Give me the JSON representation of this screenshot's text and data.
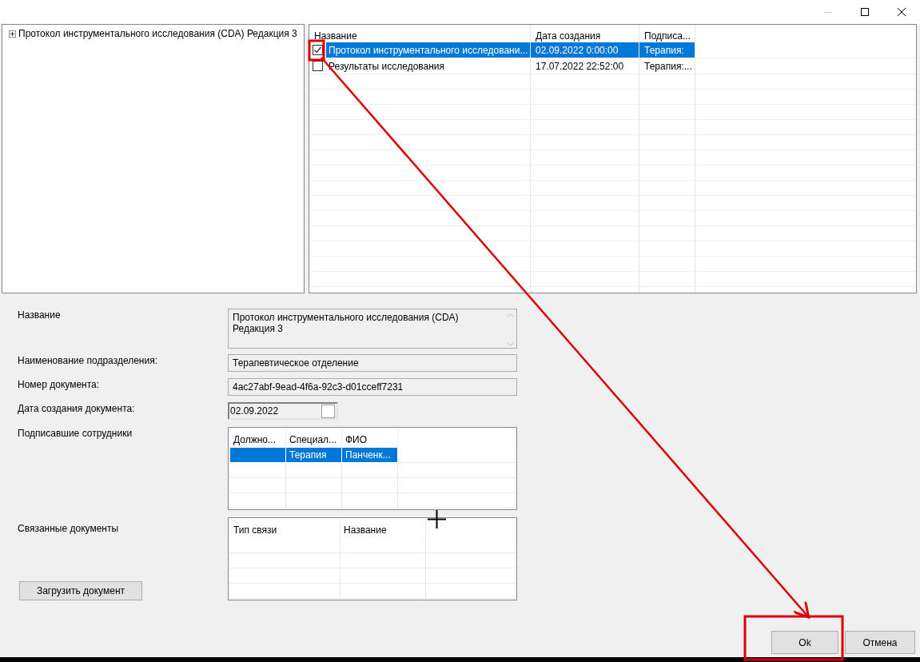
{
  "window": {
    "buttons": [
      {
        "kind": "minimize",
        "disabled": true
      },
      {
        "kind": "maximize",
        "disabled": false
      },
      {
        "kind": "close",
        "disabled": false
      }
    ]
  },
  "tree": {
    "items": [
      {
        "label": "Протокол инструментального исследования (CDA) Редакция 3",
        "expanded": false
      }
    ]
  },
  "documents": {
    "columns": [
      "Название",
      "Дата создания",
      "Подписа..."
    ],
    "rows": [
      {
        "checked": true,
        "selected": true,
        "cells": [
          "Протокол инструментального исследовани...",
          "02.09.2022 0:00:00",
          "Терапия:"
        ]
      },
      {
        "checked": false,
        "selected": false,
        "cells": [
          "Результаты исследования",
          "17.07.2022 22:52:00",
          "Терапия:..."
        ]
      }
    ]
  },
  "form": {
    "fields": [
      {
        "kind": "memo",
        "label": "Название",
        "value": "Протокол инструментального исследования (CDA)\nРедакция 3"
      },
      {
        "kind": "text",
        "label": "Наименование подразделения:",
        "value": "Терапевтическое отделение"
      },
      {
        "kind": "text",
        "label": "Номер документа:",
        "value": "4ac27abf-9ead-4f6a-92c3-d01cceff7231"
      },
      {
        "kind": "date",
        "label": "Дата создания документа:",
        "value": "02.09.2022",
        "checked": false
      }
    ],
    "signers": {
      "label": "Подписавшие сотрудники",
      "columns": [
        "Должно...",
        "Специал...",
        "ФИО"
      ],
      "rows": [
        {
          "selected": true,
          "cells": [
            null,
            "Терапия",
            "Панченк..."
          ]
        }
      ]
    },
    "related": {
      "label": "Связанные документы",
      "columns": [
        "Тип связи",
        "Название"
      ]
    },
    "upload_button": "Загрузить документ"
  },
  "buttons": [
    {
      "label": "Ok"
    },
    {
      "label": "Отмена"
    }
  ]
}
